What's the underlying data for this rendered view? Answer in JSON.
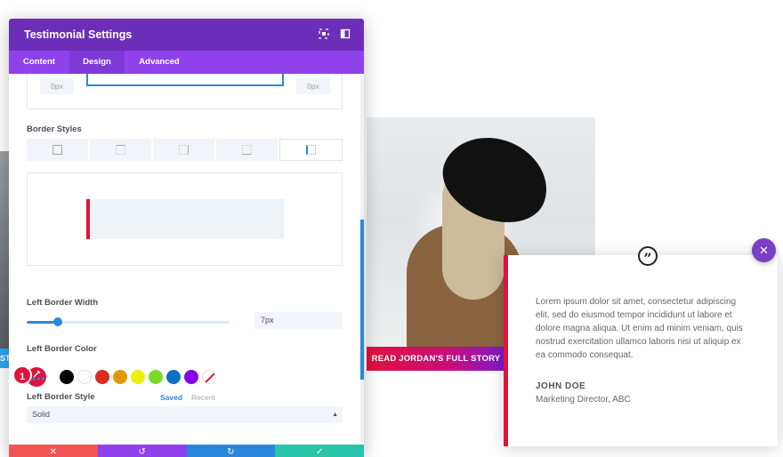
{
  "panel": {
    "title": "Testimonial Settings",
    "tabs": [
      {
        "label": "Content"
      },
      {
        "label": "Design",
        "active": true
      },
      {
        "label": "Advanced"
      }
    ],
    "border_preview": {
      "left_px": "0px",
      "right_px": "0px"
    },
    "border_styles_label": "Border Styles",
    "left_border_width_label": "Left Border Width",
    "left_border_width_value": "7px",
    "slider_value_fraction": 0.15,
    "left_border_color_label": "Left Border Color",
    "step_badge": "1",
    "swatches": [
      "#000000",
      "#ffffff",
      "#e02b20",
      "#e09900",
      "#edf000",
      "#7cda24",
      "#0c71c3",
      "#8300e9"
    ],
    "saved_label": "Saved",
    "recent_label": "Recent",
    "dots": "•••",
    "left_border_style_label": "Left Border Style",
    "left_border_style_value": "Solid",
    "footer_colors": [
      "#ef5555",
      "#8f42ec",
      "#2b87da",
      "#29c4a9"
    ]
  },
  "page": {
    "cta_label": "READ JORDAN'S FULL STORY",
    "left_badge": "ST",
    "testimonial": {
      "body": "Lorem ipsum dolor sit amet, consectetur adipiscing elit, sed do eiusmod tempor incididunt ut labore et dolore magna aliqua. Ut enim ad minim veniam, quis nostrud exercitation ullamco laboris nisi ut aliquip ex ea commodo consequat.",
      "name": "JOHN DOE",
      "title": "Marketing Director, ABC",
      "accent": "#e0123d"
    },
    "close_color": "#7b3fc4"
  }
}
